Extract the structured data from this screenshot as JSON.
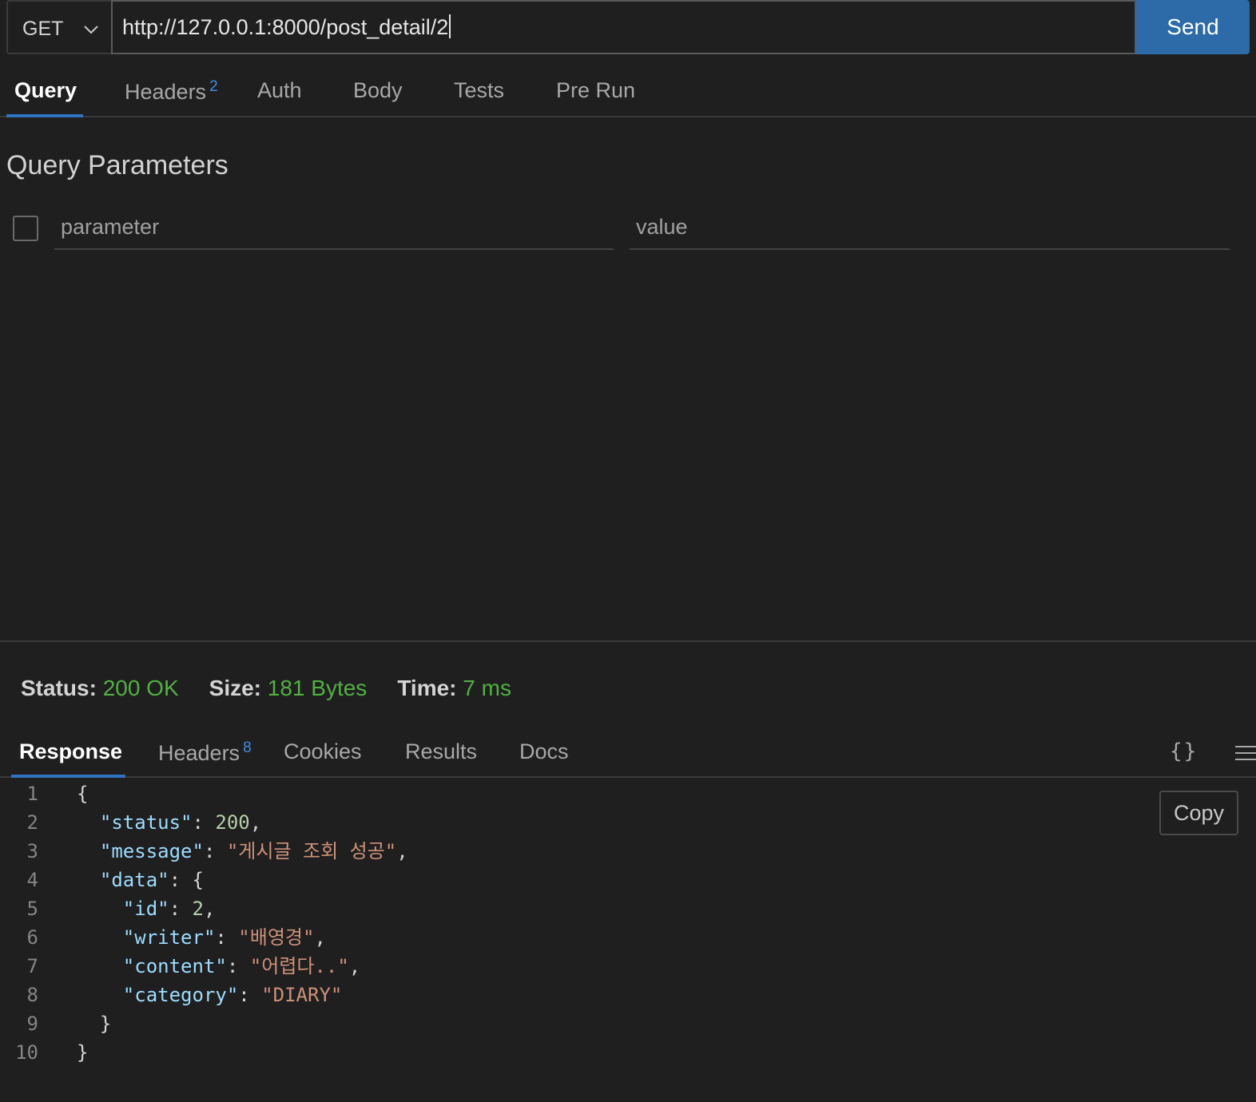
{
  "request": {
    "method": "GET",
    "url": "http://127.0.0.1:8000/post_detail/2",
    "send_label": "Send"
  },
  "request_tabs": [
    {
      "label": "Query",
      "active": true
    },
    {
      "label": "Headers",
      "badge": "2"
    },
    {
      "label": "Auth"
    },
    {
      "label": "Body"
    },
    {
      "label": "Tests"
    },
    {
      "label": "Pre Run"
    }
  ],
  "query": {
    "title": "Query Parameters",
    "parameter_placeholder": "parameter",
    "value_placeholder": "value"
  },
  "status": {
    "status_label": "Status:",
    "status_value": "200 OK",
    "size_label": "Size:",
    "size_value": "181 Bytes",
    "time_label": "Time:",
    "time_value": "7 ms",
    "value_color": "#52b043"
  },
  "response_tabs": [
    {
      "label": "Response",
      "active": true
    },
    {
      "label": "Headers",
      "badge": "8"
    },
    {
      "label": "Cookies"
    },
    {
      "label": "Results"
    },
    {
      "label": "Docs"
    }
  ],
  "response_tools": {
    "format_icon": "braces-icon",
    "format_glyph": "{}",
    "menu_icon": "menu-lines-icon",
    "copy_label": "Copy"
  },
  "response_body": {
    "lines": [
      {
        "n": "1",
        "tokens": [
          {
            "t": "{",
            "c": "p"
          }
        ]
      },
      {
        "n": "2",
        "tokens": [
          {
            "t": "  ",
            "c": "p"
          },
          {
            "t": "\"status\"",
            "c": "k"
          },
          {
            "t": ": ",
            "c": "p"
          },
          {
            "t": "200",
            "c": "n"
          },
          {
            "t": ",",
            "c": "p"
          }
        ]
      },
      {
        "n": "3",
        "tokens": [
          {
            "t": "  ",
            "c": "p"
          },
          {
            "t": "\"message\"",
            "c": "k"
          },
          {
            "t": ": ",
            "c": "p"
          },
          {
            "t": "\"게시글 조회 성공\"",
            "c": "s"
          },
          {
            "t": ",",
            "c": "p"
          }
        ]
      },
      {
        "n": "4",
        "tokens": [
          {
            "t": "  ",
            "c": "p"
          },
          {
            "t": "\"data\"",
            "c": "k"
          },
          {
            "t": ": {",
            "c": "p"
          }
        ]
      },
      {
        "n": "5",
        "tokens": [
          {
            "t": "    ",
            "c": "p"
          },
          {
            "t": "\"id\"",
            "c": "k"
          },
          {
            "t": ": ",
            "c": "p"
          },
          {
            "t": "2",
            "c": "n"
          },
          {
            "t": ",",
            "c": "p"
          }
        ]
      },
      {
        "n": "6",
        "tokens": [
          {
            "t": "    ",
            "c": "p"
          },
          {
            "t": "\"writer\"",
            "c": "k"
          },
          {
            "t": ": ",
            "c": "p"
          },
          {
            "t": "\"배영경\"",
            "c": "s"
          },
          {
            "t": ",",
            "c": "p"
          }
        ]
      },
      {
        "n": "7",
        "tokens": [
          {
            "t": "    ",
            "c": "p"
          },
          {
            "t": "\"content\"",
            "c": "k"
          },
          {
            "t": ": ",
            "c": "p"
          },
          {
            "t": "\"어렵다..\"",
            "c": "s"
          },
          {
            "t": ",",
            "c": "p"
          }
        ]
      },
      {
        "n": "8",
        "tokens": [
          {
            "t": "    ",
            "c": "p"
          },
          {
            "t": "\"category\"",
            "c": "k"
          },
          {
            "t": ": ",
            "c": "p"
          },
          {
            "t": "\"DIARY\"",
            "c": "s"
          }
        ]
      },
      {
        "n": "9",
        "tokens": [
          {
            "t": "  }",
            "c": "p"
          }
        ]
      },
      {
        "n": "10",
        "tokens": [
          {
            "t": "}",
            "c": "p"
          }
        ]
      }
    ]
  },
  "colors": {
    "accent": "#2c6aa8",
    "tab_underline": "#2f72c0",
    "badge": "#3d8ee6",
    "json_key": "#9cdcfe",
    "json_string": "#ce9178",
    "json_number": "#b5cea8"
  }
}
